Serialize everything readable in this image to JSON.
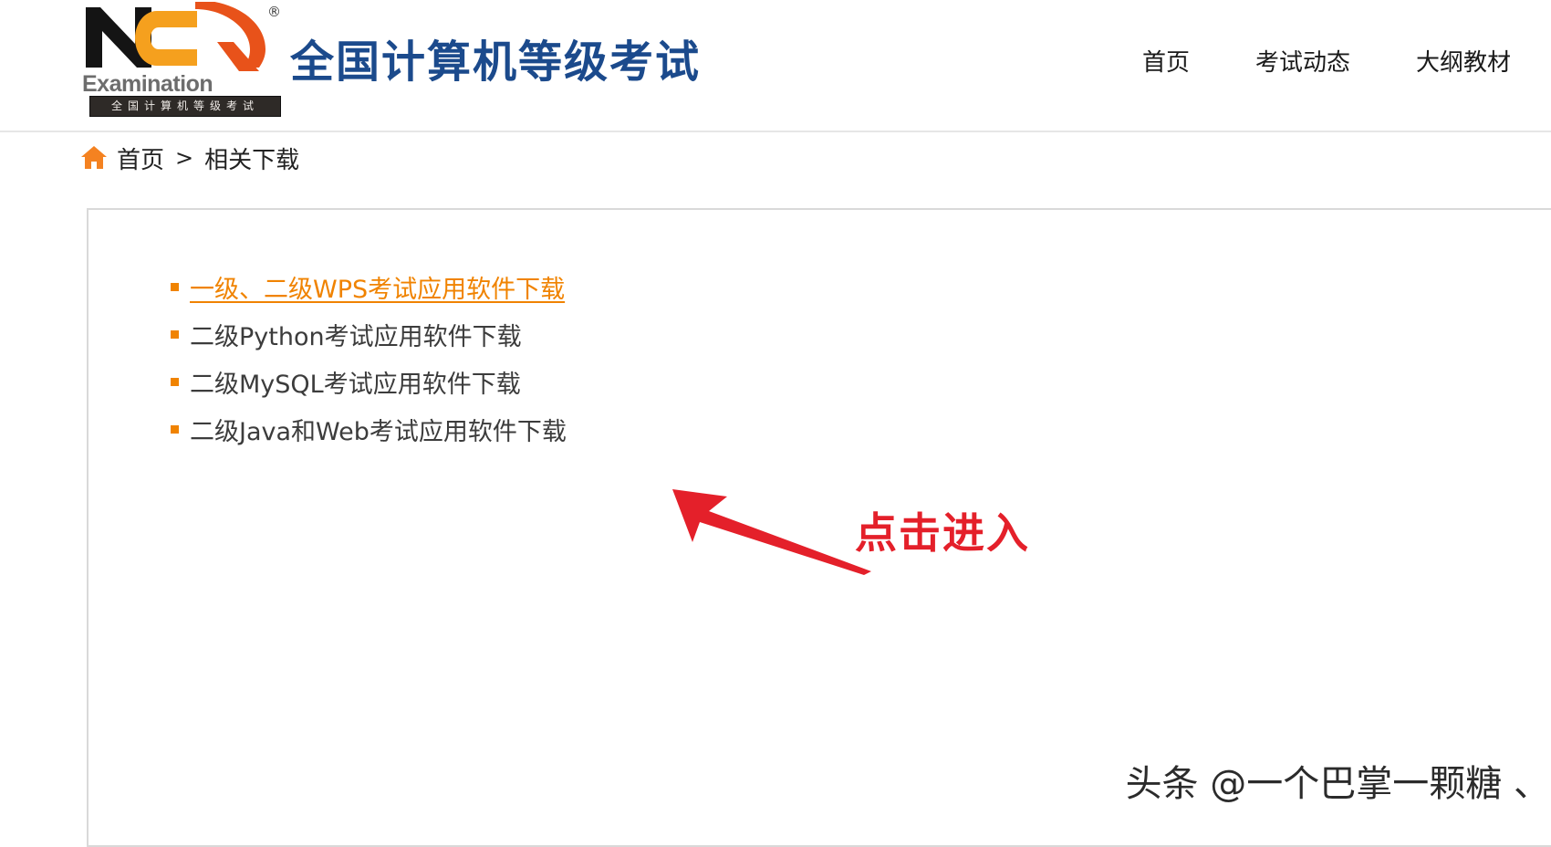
{
  "header": {
    "logo": {
      "mark_alt": "ncre-logo",
      "wordmark": "Examination",
      "bar_text": "全国计算机等级考试",
      "registered_mark": "®"
    },
    "site_title": "全国计算机等级考试",
    "nav": [
      {
        "label": "首页",
        "name": "nav-home"
      },
      {
        "label": "考试动态",
        "name": "nav-exam-news"
      },
      {
        "label": "大纲教材",
        "name": "nav-syllabus-materials"
      }
    ]
  },
  "breadcrumb": {
    "home_icon": "home-icon",
    "home_label": "首页",
    "separator": ">",
    "current": "相关下载"
  },
  "content": {
    "downloads": [
      {
        "label": "一级、二级WPS考试应用软件下载",
        "active": true
      },
      {
        "label": "二级Python考试应用软件下载",
        "active": false
      },
      {
        "label": "二级MySQL考试应用软件下载",
        "active": false
      },
      {
        "label": "二级Java和Web考试应用软件下载",
        "active": false
      }
    ]
  },
  "annotation": {
    "text": "点击进入",
    "arrow_icon": "red-arrow-icon",
    "color": "#e4202a"
  },
  "watermark": {
    "text": "头条 @一个巴掌一颗糖 、"
  },
  "colors": {
    "brand_orange": "#f08300",
    "brand_blue": "#1b4a8c",
    "annotation_red": "#e4202a",
    "panel_border": "#d9d9d9",
    "text_dark": "#3c3c3c"
  }
}
